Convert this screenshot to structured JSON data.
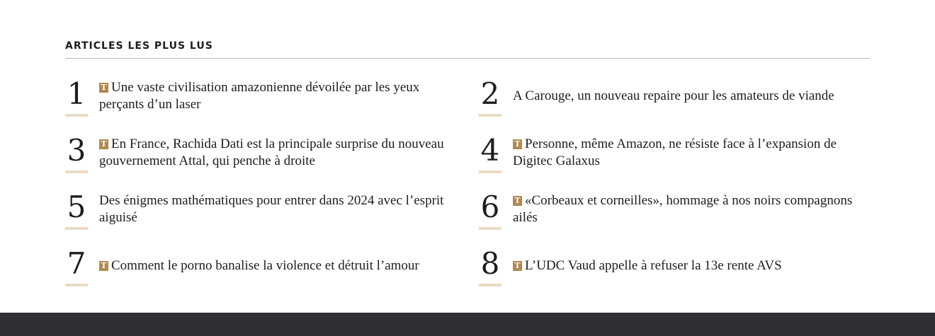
{
  "section": {
    "title": "ARTICLES LES PLUS LUS"
  },
  "colors": {
    "badge": "#b0894e",
    "number_underline": "#eadbc4",
    "footer": "#303033"
  },
  "badge_label": "T",
  "articles": [
    {
      "rank": "1",
      "premium": true,
      "title": "Une vaste civilisation amazonienne dévoilée par les yeux perçants d’un laser"
    },
    {
      "rank": "2",
      "premium": false,
      "title": "A Carouge, un nouveau repaire pour les amateurs de viande"
    },
    {
      "rank": "3",
      "premium": true,
      "title": "En France, Rachida Dati est la principale surprise du nouveau gouvernement Attal, qui penche à droite"
    },
    {
      "rank": "4",
      "premium": true,
      "title": "Personne, même Amazon, ne résiste face à l’expansion de Digitec Galaxus"
    },
    {
      "rank": "5",
      "premium": false,
      "title": "Des énigmes mathématiques pour entrer dans 2024 avec l’esprit aiguisé"
    },
    {
      "rank": "6",
      "premium": true,
      "title": "«Corbeaux et corneilles», hommage à nos noirs compagnons ailés"
    },
    {
      "rank": "7",
      "premium": true,
      "title": "Comment le porno banalise la violence et détruit l’amour"
    },
    {
      "rank": "8",
      "premium": true,
      "title": "L’UDC Vaud appelle à refuser la 13e rente AVS"
    }
  ]
}
